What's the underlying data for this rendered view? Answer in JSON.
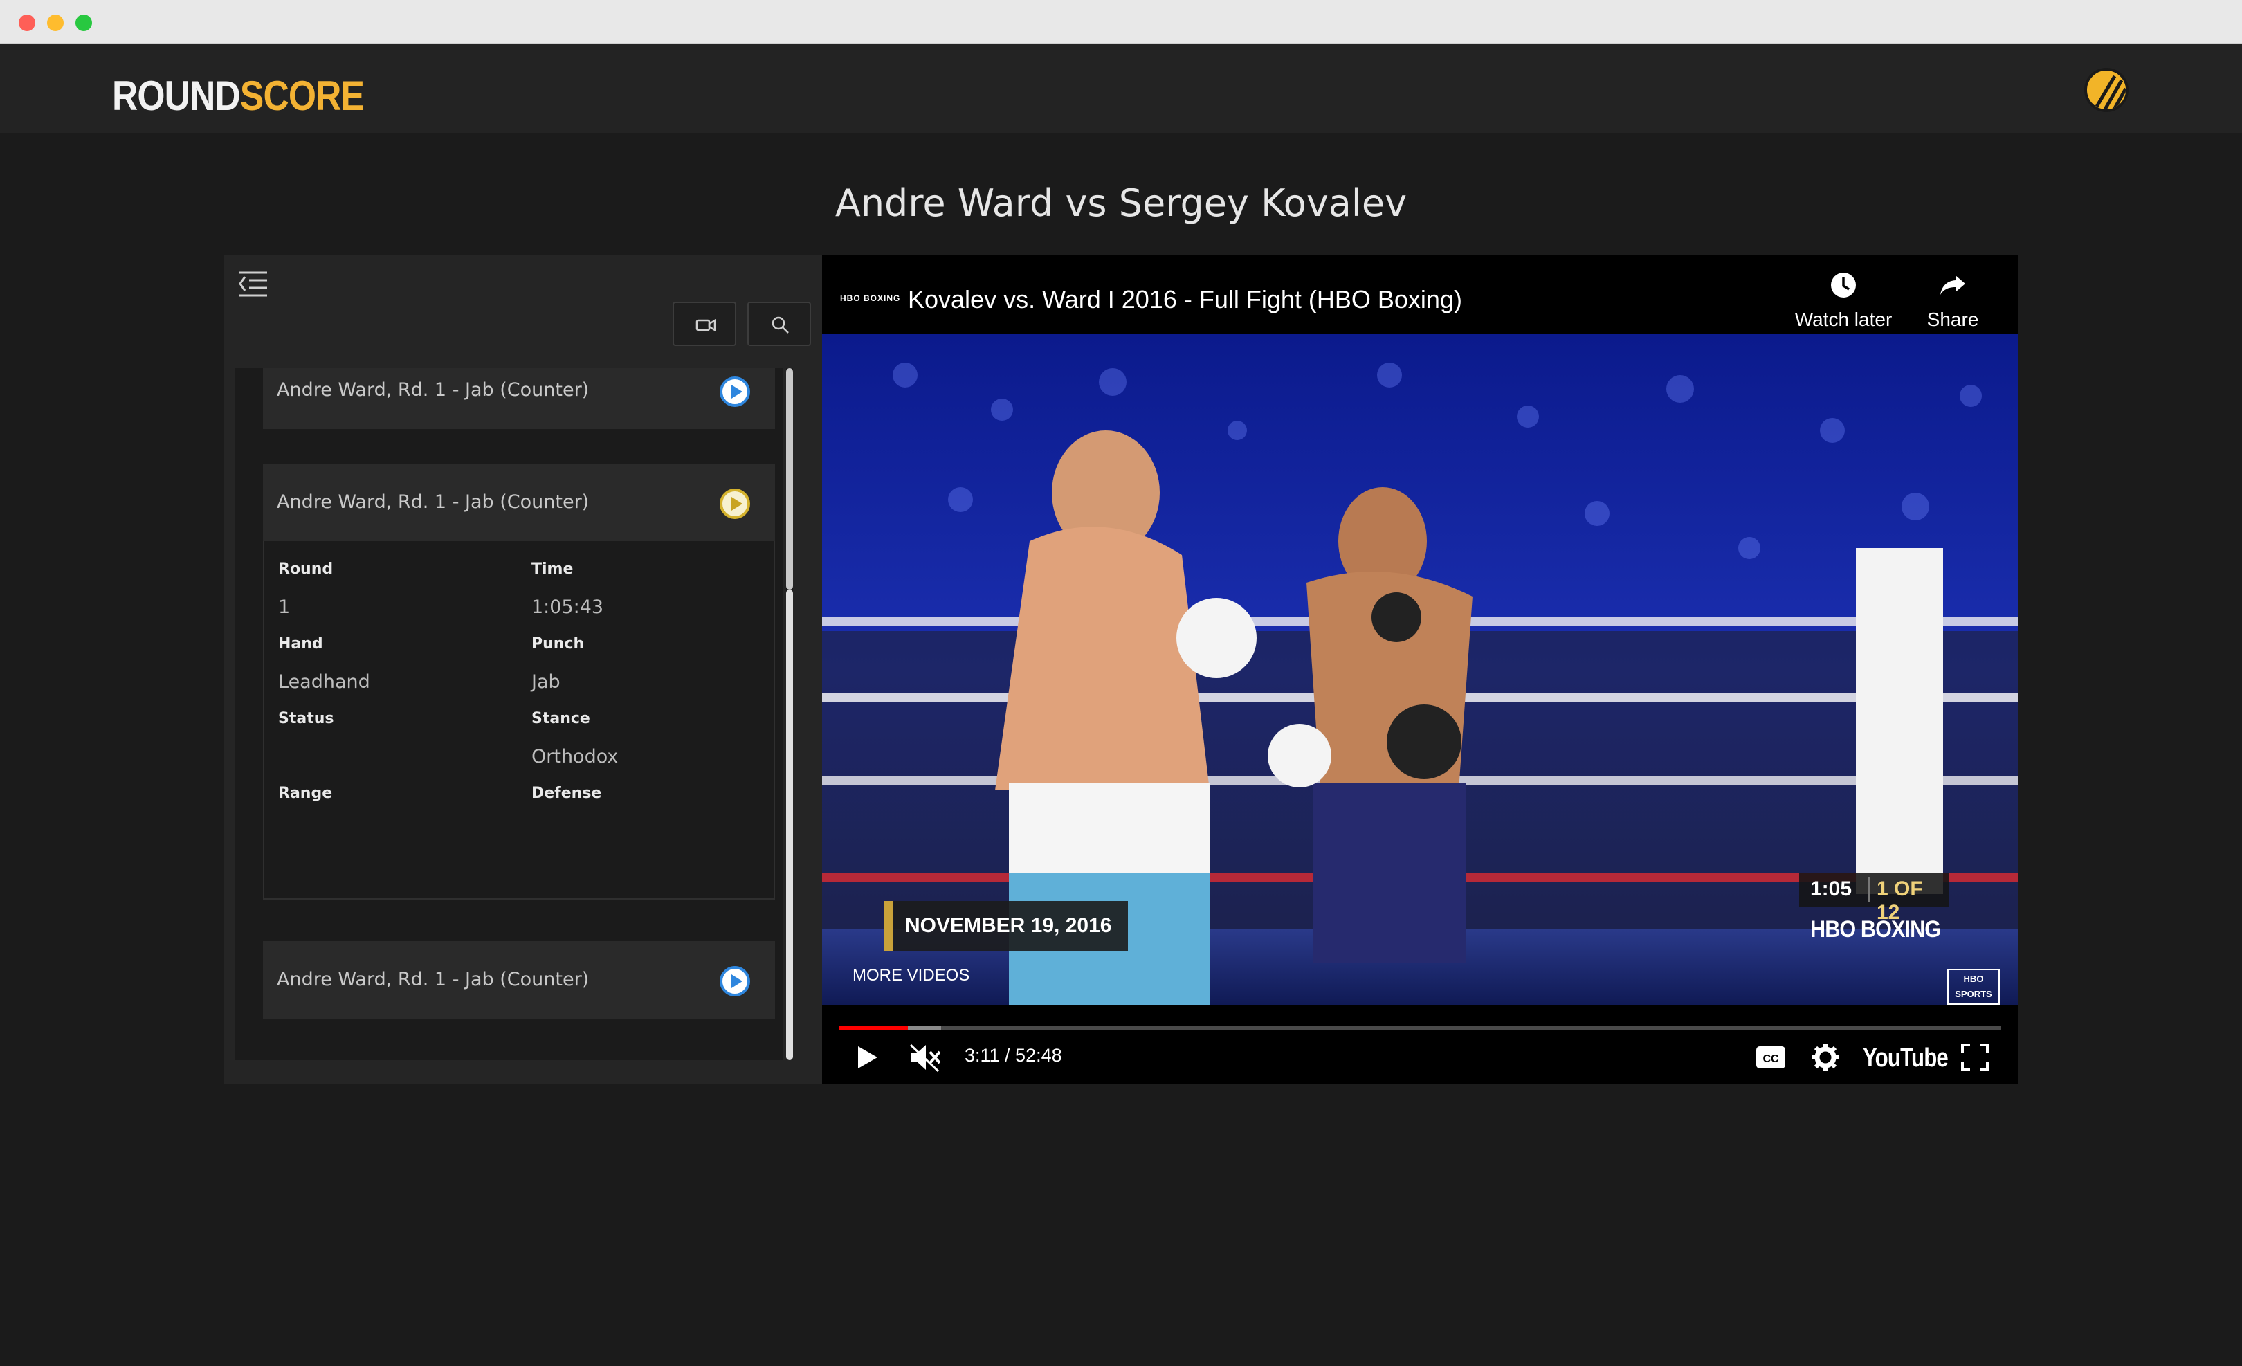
{
  "brand": {
    "part1": "ROUND",
    "part2": "SCORE"
  },
  "page": {
    "title": "Andre Ward vs Sergey Kovalev"
  },
  "sidebar": {
    "clips": [
      {
        "label": "Andre Ward, Rd. 1 - Jab (Counter)"
      },
      {
        "label": "Andre Ward, Rd. 1 - Jab (Counter)",
        "expanded": true
      },
      {
        "label": "Andre Ward, Rd. 1 - Jab (Counter)"
      }
    ],
    "details": {
      "round_label": "Round",
      "round_value": "1",
      "time_label": "Time",
      "time_value": "1:05:43",
      "hand_label": "Hand",
      "hand_value": "Leadhand",
      "punch_label": "Punch",
      "punch_value": "Jab",
      "status_label": "Status",
      "status_value": "",
      "stance_label": "Stance",
      "stance_value": "Orthodox",
      "range_label": "Range",
      "range_value": "",
      "defense_label": "Defense",
      "defense_value": ""
    }
  },
  "player": {
    "channel_logo": "HBO BOXING",
    "title": "Kovalev vs. Ward I 2016 - Full Fight (HBO Boxing)",
    "watch_later": "Watch later",
    "share": "Share",
    "time": "3:11 / 52:48",
    "brand": "YouTube",
    "more_videos": "MORE VIDEOS",
    "progress_played": 0.0595,
    "progress_buffered": 0.088
  },
  "broadcast": {
    "date": "NOVEMBER 19, 2016",
    "clock": "1:05",
    "round": "1 OF 12",
    "network": "HBO BOXING",
    "corner_logo_line1": "HBO",
    "corner_logo_line2": "SPORTS"
  },
  "colors": {
    "accent": "#f3b233",
    "progress": "#ff0000",
    "clip_icon": "#2e86de",
    "clip_icon_active": "#d4b22d"
  }
}
